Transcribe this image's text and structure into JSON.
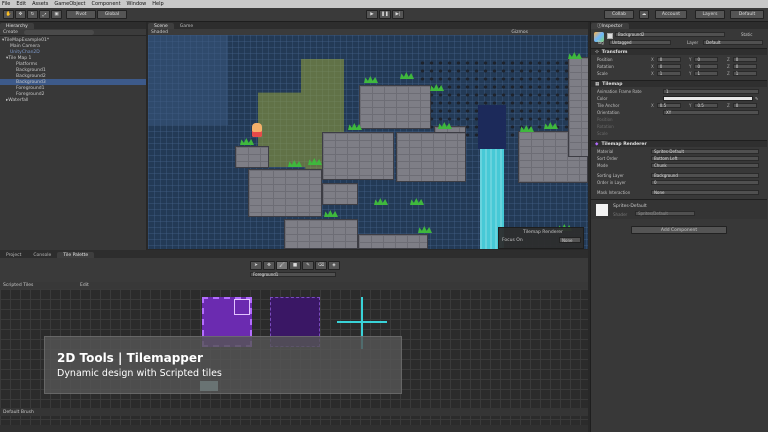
{
  "menu": [
    "File",
    "Edit",
    "Assets",
    "GameObject",
    "Component",
    "Window",
    "Help"
  ],
  "toolbar": {
    "pivot": "Pivot",
    "global": "Global",
    "collab": "Collab",
    "account": "Account",
    "layers": "Layers",
    "layout": "Default"
  },
  "hierarchy": {
    "tab": "Hierarchy",
    "create": "Create",
    "items": [
      {
        "label": "TileMapExample01*",
        "indent": 0
      },
      {
        "label": "Main Camera",
        "indent": 1
      },
      {
        "label": "UnityChan2D",
        "indent": 1
      },
      {
        "label": "Tile Map 1",
        "indent": 1
      },
      {
        "label": "Platforms",
        "indent": 2
      },
      {
        "label": "Background1",
        "indent": 2
      },
      {
        "label": "Background2",
        "indent": 2
      },
      {
        "label": "Background3",
        "indent": 2
      },
      {
        "label": "Foreground1",
        "indent": 2
      },
      {
        "label": "Foreground2",
        "indent": 2
      },
      {
        "label": "Waterfall",
        "indent": 1
      }
    ]
  },
  "scene": {
    "tab_scene": "Scene",
    "tab_game": "Game",
    "shaded": "Shaded",
    "gizmos": "Gizmos",
    "renderer_popup": {
      "title": "Tilemap Renderer",
      "focus": "Focus On",
      "value": "None"
    }
  },
  "inspector": {
    "tab": "Inspector",
    "object_name": "Background2",
    "static_label": "Static",
    "tag_label": "Tag",
    "tag_value": "Untagged",
    "layer_label": "Layer",
    "layer_value": "Default",
    "transform": {
      "title": "Transform",
      "position": {
        "label": "Position",
        "x": "0",
        "y": "0",
        "z": "0"
      },
      "rotation": {
        "label": "Rotation",
        "x": "0",
        "y": "0",
        "z": "0"
      },
      "scale": {
        "label": "Scale",
        "x": "1",
        "y": "1",
        "z": "1"
      }
    },
    "tilemap": {
      "title": "Tilemap",
      "anim_rate_label": "Animation Frame Rate",
      "anim_rate_value": "1",
      "color_label": "Color",
      "tile_anchor_label": "Tile Anchor",
      "tile_anchor": {
        "x": "0.5",
        "y": "0.5",
        "z": "0"
      },
      "orientation_label": "Orientation",
      "orientation_value": "XY",
      "position_label": "Position",
      "rotation_label": "Rotation",
      "scale_label": "Scale"
    },
    "renderer": {
      "title": "Tilemap Renderer",
      "material_label": "Material",
      "material_value": "Sprites-Default",
      "sort_order_label": "Sort Order",
      "sort_order_value": "Bottom Left",
      "mode_label": "Mode",
      "mode_value": "Chunk",
      "sorting_layer_label": "Sorting Layer",
      "sorting_layer_value": "Background",
      "order_label": "Order in Layer",
      "order_value": "0",
      "mask_label": "Mask Interaction",
      "mask_value": "None"
    },
    "material": {
      "name": "Sprites-Default",
      "shader_label": "Shader",
      "shader_value": "Sprites/Default"
    },
    "add_component": "Add Component"
  },
  "bottom": {
    "tabs": [
      "Project",
      "Console",
      "Tile Palette"
    ],
    "active_tab": "Tile Palette",
    "palette_dropdown": "Foreground1",
    "palette_name": "Scripted Tiles",
    "edit": "Edit",
    "default_brush": "Default Brush"
  },
  "caption": {
    "title": "2D Tools | Tilemapper",
    "subtitle": "Dynamic design with Scripted tiles"
  },
  "colors": {
    "accent_selection": "#3d5a8a",
    "waterfall": "#46c9d6",
    "purple_tile": "#6b2bb0",
    "crosshair": "#39d3d8"
  }
}
